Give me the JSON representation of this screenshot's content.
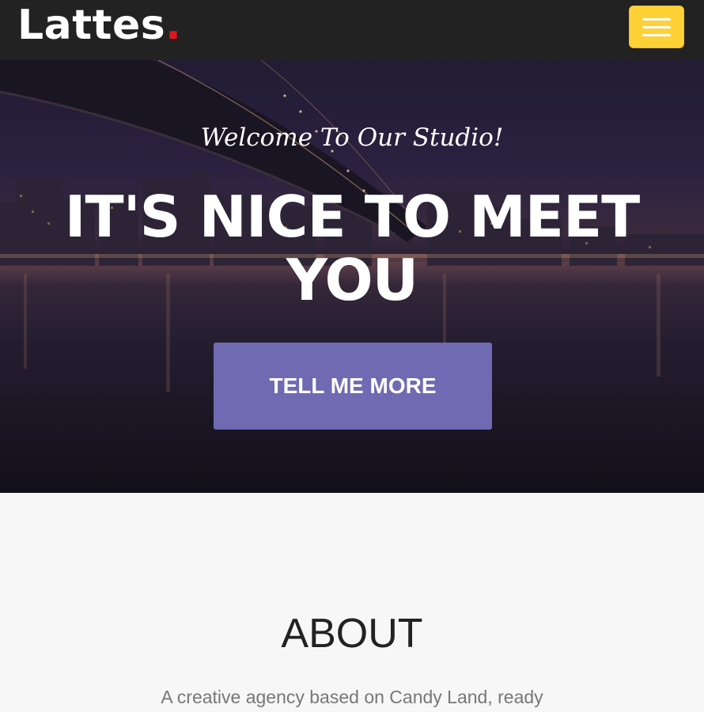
{
  "nav": {
    "brand_text": "Lattes",
    "brand_dot": ".",
    "menu_icon": "hamburger-menu-icon",
    "accent_color": "#fed136",
    "dot_color": "#e0161e"
  },
  "hero": {
    "subtitle": "Welcome To Our Studio!",
    "title": "IT'S NICE TO MEET YOU",
    "cta_label": "TELL ME MORE",
    "cta_color": "#6f6ab2"
  },
  "about": {
    "heading": "ABOUT",
    "text": "A creative agency based on Candy Land, ready"
  }
}
